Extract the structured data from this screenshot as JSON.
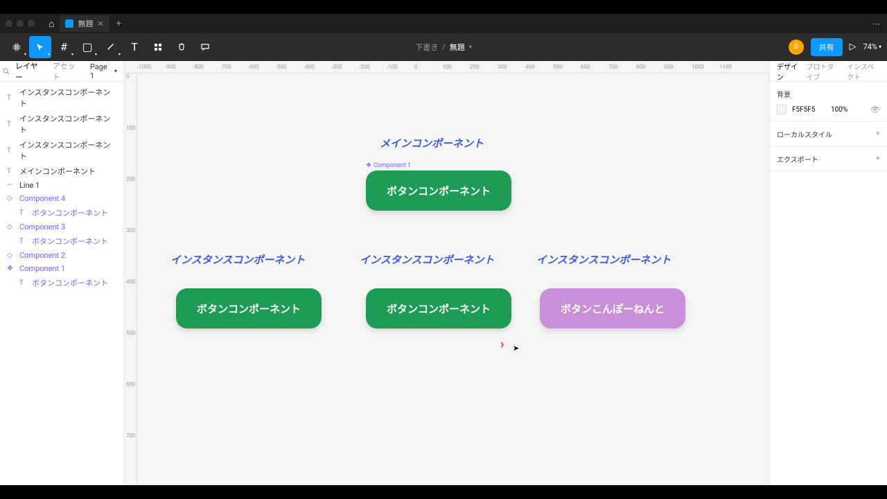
{
  "titlebar": {
    "tab_name": "無題"
  },
  "toolbar": {
    "center_status": "下書き",
    "center_filename": "無題",
    "avatar_letter": "S",
    "share_label": "共有",
    "zoom": "74%"
  },
  "left_panel": {
    "tab_layers": "レイヤー",
    "tab_assets": "アセット",
    "page_selector": "Page 1",
    "layers": [
      {
        "icon": "T",
        "label": "インスタンスコンポーネント",
        "purple": false,
        "child": false
      },
      {
        "icon": "T",
        "label": "インスタンスコンポーネント",
        "purple": false,
        "child": false
      },
      {
        "icon": "T",
        "label": "インスタンスコンポーネント",
        "purple": false,
        "child": false
      },
      {
        "icon": "T",
        "label": "メインコンポーネント",
        "purple": false,
        "child": false
      },
      {
        "icon": "—",
        "label": "Line 1",
        "purple": false,
        "child": false
      },
      {
        "icon": "◇",
        "label": "Component 4",
        "purple": true,
        "child": false
      },
      {
        "icon": "T",
        "label": "ボタンコンポーネント",
        "purple": true,
        "child": true
      },
      {
        "icon": "◇",
        "label": "Component 3",
        "purple": true,
        "child": false
      },
      {
        "icon": "T",
        "label": "ボタンコンポーネント",
        "purple": true,
        "child": true
      },
      {
        "icon": "◇",
        "label": "Component 2",
        "purple": true,
        "child": false
      },
      {
        "icon": "❖",
        "label": "Component 1",
        "purple": true,
        "child": false
      },
      {
        "icon": "T",
        "label": "ボタンコンポーネント",
        "purple": true,
        "child": true
      }
    ]
  },
  "canvas": {
    "ruler_h": [
      "-1000",
      "-900",
      "-800",
      "-700",
      "-600",
      "-500",
      "-400",
      "-300",
      "-200",
      "-100",
      "0",
      "100",
      "200",
      "300",
      "400",
      "500",
      "600",
      "700",
      "800",
      "900",
      "1000",
      "1100"
    ],
    "ruler_v": [
      "0",
      "100",
      "200",
      "300",
      "400",
      "500",
      "600",
      "700"
    ],
    "main_label": "メインコンポーネント",
    "instance_label": "インスタンスコンポーネント",
    "component_label": "Component 1",
    "btn_text": "ボタンコンポーネント",
    "btn_text_purple": "ボタンこんぽーねんと"
  },
  "right_panel": {
    "tab_design": "デザイン",
    "tab_prototype": "プロトタイプ",
    "tab_inspect": "インスペクト",
    "bg_title": "背景",
    "bg_hex": "F5F5F5",
    "bg_opacity": "100%",
    "local_styles": "ローカルスタイル",
    "export": "エクスポート"
  }
}
